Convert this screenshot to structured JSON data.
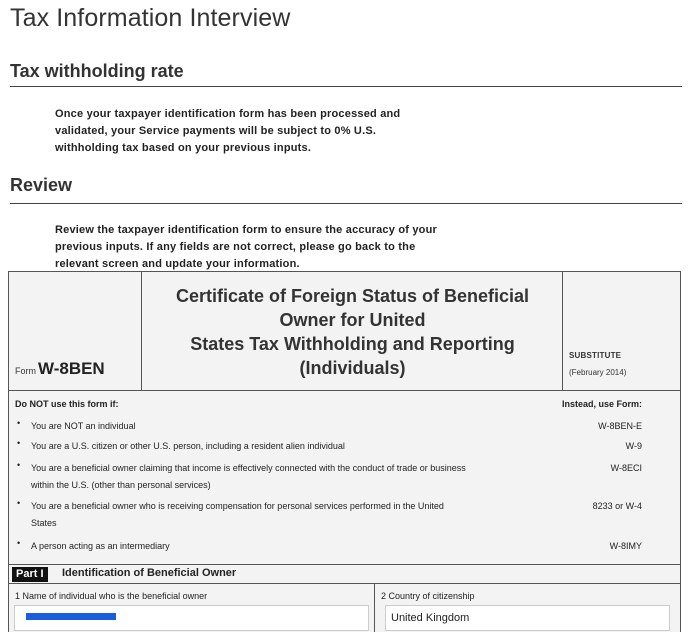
{
  "page": {
    "title": "Tax Information Interview"
  },
  "withholding": {
    "heading": "Tax withholding rate",
    "lines": [
      "Once your taxpayer identification form has been processed and",
      "validated, your Service payments will be subject to 0% U.S.",
      "withholding tax based on your previous inputs."
    ]
  },
  "review": {
    "heading": "Review",
    "lines": [
      "Review the taxpayer identification form to ensure the accuracy of your",
      "previous inputs. If any fields are not correct, please go back to the",
      "relevant screen and update your information."
    ]
  },
  "form": {
    "form_word": "Form",
    "form_code": "W-8BEN",
    "title_lines": [
      "Certificate of Foreign Status of Beneficial",
      "Owner for United",
      "States Tax Withholding and Reporting",
      "(Individuals)"
    ],
    "substitute": "SUBSTITUTE",
    "substitute_date": "(February 2014)",
    "not_use_heading": "Do NOT use this form if:",
    "instead_heading": "Instead, use Form:",
    "bullet_glyph": "•",
    "rows": [
      {
        "lines": [
          "You are NOT an individual"
        ],
        "alt": "W-8BEN-E"
      },
      {
        "lines": [
          "You are a U.S. citizen or other U.S. person, including a resident alien individual"
        ],
        "alt": "W-9"
      },
      {
        "lines": [
          "You are a beneficial owner claiming that income is effectively connected with the conduct of trade or business",
          "within the U.S. (other than personal services)"
        ],
        "alt": "W-8ECI"
      },
      {
        "lines": [
          "You are a beneficial owner who is receiving compensation for personal services performed in the United",
          "States"
        ],
        "alt": "8233 or W-4"
      },
      {
        "lines": [
          "A person acting as an intermediary"
        ],
        "alt": "W-8IMY"
      }
    ],
    "part_label": "Part I",
    "part_title": "Identification of Beneficial Owner",
    "field1_label": "1  Name of individual who is the beneficial owner",
    "field1_value": "",
    "field2_label": "2  Country of citizenship",
    "field2_value": "United Kingdom"
  }
}
